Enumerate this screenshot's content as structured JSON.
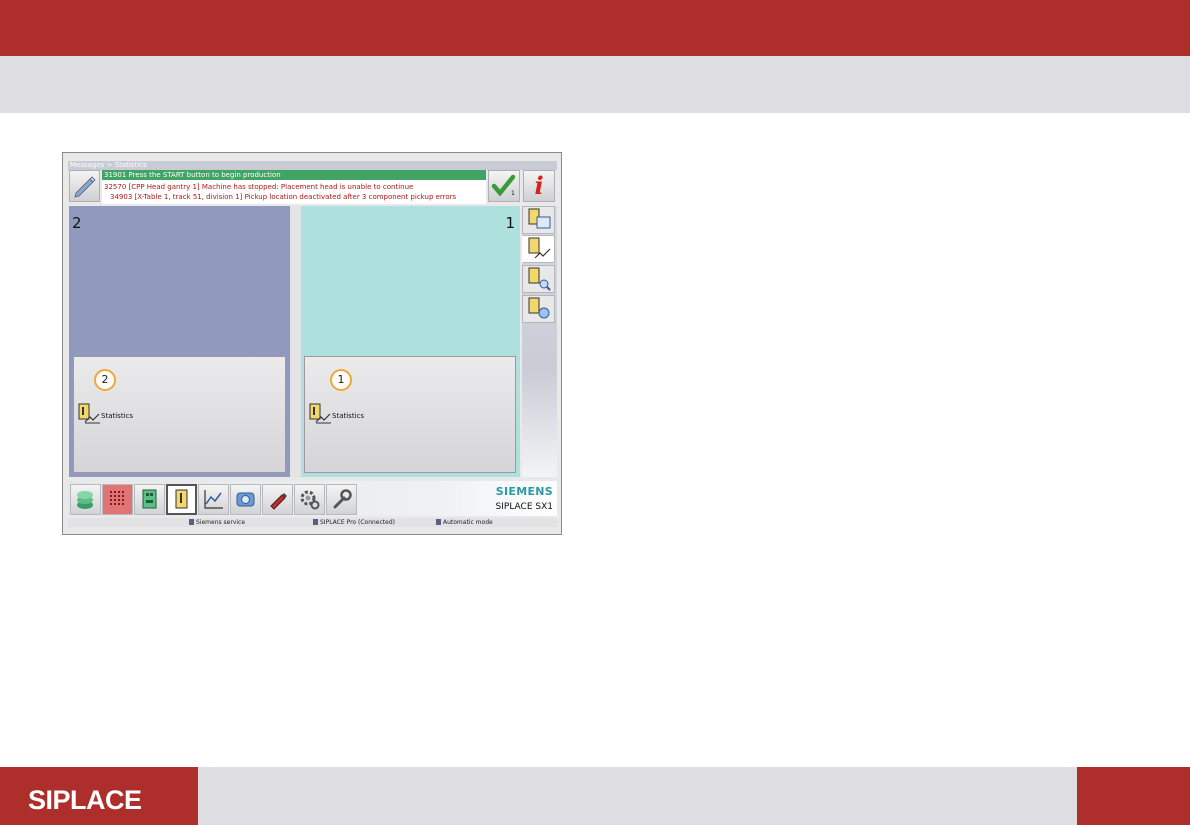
{
  "slide": {
    "footer_logo": "SIPLACE"
  },
  "screen": {
    "breadcrumb": "Messages > Statistics",
    "messages": [
      "31901 Press the START button to begin production",
      "32570 [CPP Head gantry 1] Machine has stopped: Placement head is unable to continue",
      "34903 [X-Table 1, track 51, division 1] Pickup location deactivated after 3 component pickup errors"
    ],
    "check_count": "1",
    "info_label": "i",
    "panels": [
      {
        "number": "2",
        "callout": "2",
        "card_label": "Statistics"
      },
      {
        "number": "1",
        "callout": "1",
        "card_label": "Statistics"
      }
    ],
    "rail_tabs": [
      "statistics-window-icon",
      "statistics-chart-icon",
      "statistics-search-icon",
      "statistics-zoom-icon"
    ],
    "toolbar_icons": [
      "stack-icon",
      "grid-icon",
      "board-icon",
      "statistics-icon",
      "graph-icon",
      "camera-icon",
      "pen-icon",
      "gear-icon",
      "wrench-icon"
    ],
    "brand": "SIEMENS",
    "machine": "SIPLACE SX1",
    "status": {
      "service": "Siemens service",
      "pro": "SIPLACE Pro (Connected)",
      "mode": "Automatic mode"
    }
  },
  "colors": {
    "brand_red": "#ad2e2b",
    "band_gray": "#dedde1",
    "panel_2": "#9299be",
    "panel_1": "#aee0dd",
    "msg_green": "#41a464",
    "msg_red": "#b21717",
    "siemens_teal": "#2a9aa6"
  }
}
